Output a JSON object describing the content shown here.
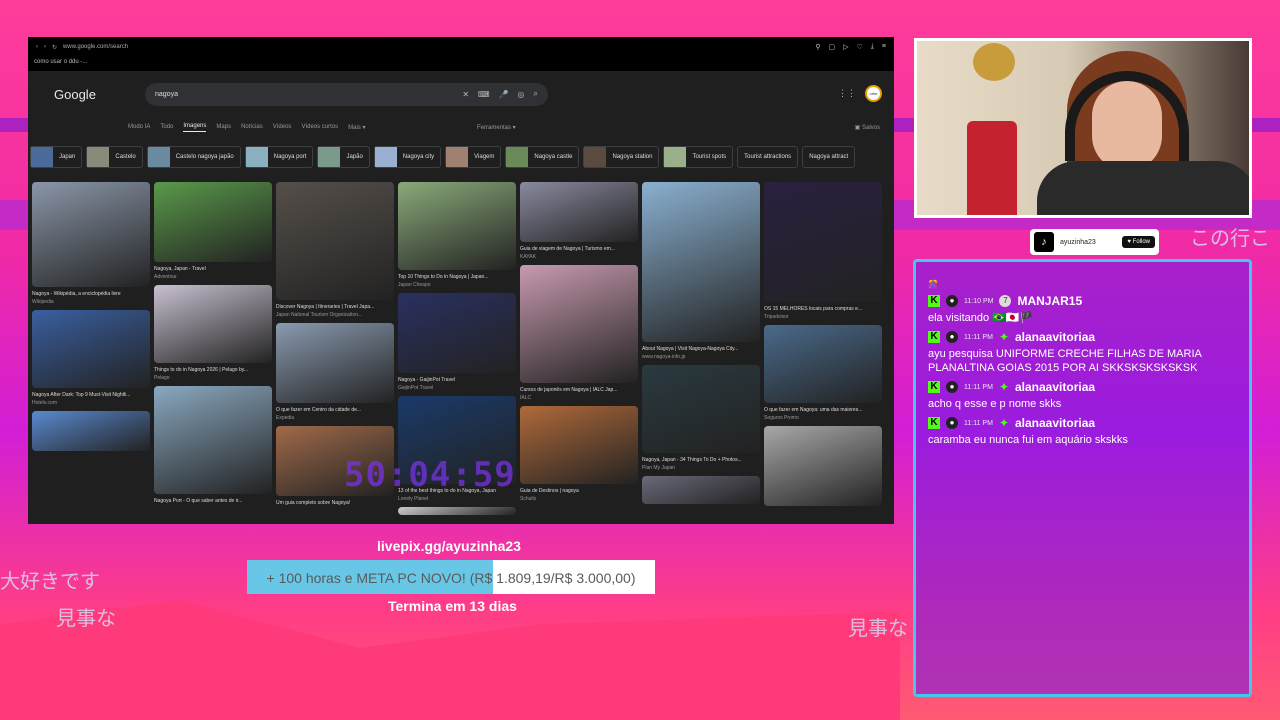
{
  "browser": {
    "url": "www.google.com/search",
    "bookmark": "como usar o ddu -...",
    "logo": "Google",
    "query": "nagoya",
    "avatar_text": "orbe",
    "tabs": [
      "Modo IA",
      "Todo",
      "Imagens",
      "Maps",
      "Notícias",
      "Vídeos",
      "Vídeos curtos",
      "Mais ▾"
    ],
    "tools_label": "Ferramentas ▾",
    "saved_label": "Salvos",
    "chips": [
      {
        "label": "Japan",
        "img": true
      },
      {
        "label": "Castelo",
        "img": true
      },
      {
        "label": "Castelo nagoya japão",
        "img": true
      },
      {
        "label": "Nagoya port",
        "img": true
      },
      {
        "label": "Japão",
        "img": true
      },
      {
        "label": "Nagoya city",
        "img": true
      },
      {
        "label": "Viagem",
        "img": true
      },
      {
        "label": "Nagoya castle",
        "img": true
      },
      {
        "label": "Nagoya station",
        "img": true
      },
      {
        "label": "Tourist spots",
        "img": true
      },
      {
        "label": "Tourist attractions",
        "img": false
      },
      {
        "label": "Nagoya attract",
        "img": false
      }
    ],
    "results": [
      [
        {
          "h": 105,
          "color": "#8a96a8",
          "cap": "Nagoya - Wikipédia, a enciclopédia livre",
          "src": "Wikipedia"
        },
        {
          "h": 78,
          "color": "#3a5fa0",
          "cap": "Nagoya After Dark: Top 9 Must-Visit Nightli...",
          "src": "Hotels.com"
        },
        {
          "h": 40,
          "color": "#5a8ad0",
          "cap": "",
          "src": ""
        }
      ],
      [
        {
          "h": 80,
          "color": "#5a9a4a",
          "cap": "Nagoya, Japan - Travel",
          "src": "Adventour"
        },
        {
          "h": 78,
          "color": "#c8c0d0",
          "cap": "Things to do in Nagoya 2026 | Pelago by...",
          "src": "Pelago"
        },
        {
          "h": 108,
          "color": "#8aa8c0",
          "cap": "Nagoya Port - O que saber antes de ir...",
          "src": ""
        }
      ],
      [
        {
          "h": 118,
          "color": "#554f4a",
          "cap": "Discover Nagoya | Itineraries | Travel Japa...",
          "src": "Japan National Tourism Organization..."
        },
        {
          "h": 80,
          "color": "#8a9ab0",
          "cap": "O que fazer em Centro da cidade de...",
          "src": "Expedia"
        },
        {
          "h": 70,
          "color": "#a06a4a",
          "cap": "Um guia completo sobre Nagoya!",
          "src": ""
        }
      ],
      [
        {
          "h": 88,
          "color": "#8aaa7a",
          "cap": "Top 10 Things to Do in Nagoya | Japan...",
          "src": "Japan Cheapo"
        },
        {
          "h": 80,
          "color": "#2a3060",
          "cap": "Nagoya - GaijinPot Travel",
          "src": "GaijinPot Travel"
        },
        {
          "h": 88,
          "color": "#1a3a6a",
          "cap": "13 of the best things to do in Nagoya, Japan",
          "src": "Lonely Planet"
        },
        {
          "h": 8,
          "color": "#cccccc",
          "cap": "",
          "src": ""
        }
      ],
      [
        {
          "h": 60,
          "color": "#8a8aa0",
          "cap": "Guia de viagem de Nagoya | Turismo em...",
          "src": "KAYAK"
        },
        {
          "h": 118,
          "color": "#c89ab0",
          "cap": "Cursos de japonês em Nagoya | IALC Jap...",
          "src": "IALC"
        },
        {
          "h": 78,
          "color": "#b06a3a",
          "cap": "Guia de Destinos | nagoya",
          "src": "Schultz"
        }
      ],
      [
        {
          "h": 160,
          "color": "#8ab0d0",
          "cap": "About Nagoya | Visit Nagoya-Nagoya City...",
          "src": "www.nagoya-info.jp"
        },
        {
          "h": 88,
          "color": "#2a3a40",
          "cap": "Nagoya, Japan - 34 Things To Do + Photos...",
          "src": "Plan My Japan"
        },
        {
          "h": 28,
          "color": "#6a6a7a",
          "cap": "",
          "src": ""
        }
      ],
      [
        {
          "h": 120,
          "color": "#2a2040",
          "cap": "OS 15 MELHORES locais para compras e...",
          "src": "Tripadvisor"
        },
        {
          "h": 78,
          "color": "#4a6a8a",
          "cap": "O que fazer em Nagoya: uma das maiores...",
          "src": "Seguros Promo"
        },
        {
          "h": 80,
          "color": "#a8a8a8",
          "cap": "",
          "src": ""
        }
      ]
    ]
  },
  "timer": "50:04:59",
  "livepix": "livepix.gg/ayuzinha23",
  "goal": {
    "text": "+ 100 horas e META PC NOVO! (R$ 1.809,19/R$ 3.000,00)",
    "progress": 0.603
  },
  "ends": "Termina em 13 dias",
  "jp": {
    "left1": "大好きです",
    "left2": "見事な",
    "right1": "見事な",
    "top_right": "この行こ"
  },
  "tiktok": {
    "handle": "ayuzinha23",
    "follow": "♥ Follow"
  },
  "chat": {
    "top_emote": "🎊",
    "messages": [
      {
        "time": "11:10 PM",
        "badge": "7",
        "user": "MANJAR15",
        "text": "ela visitando 🇧🇷🇯🇵🏴"
      },
      {
        "time": "11:11 PM",
        "badge": "✦",
        "user": "alanaavitoriaa",
        "text": "ayu pesquisa UNIFORME CRECHE FILHAS DE MARIA PLANALTINA GOIAS 2015 POR AI SKKSKSKSKSKSK"
      },
      {
        "time": "11:11 PM",
        "badge": "✦",
        "user": "alanaavitoriaa",
        "text": "acho q esse e p nome skks"
      },
      {
        "time": "11:11 PM",
        "badge": "✦",
        "user": "alanaavitoriaa",
        "text": "caramba eu nunca fui em aquário skskks"
      }
    ]
  }
}
